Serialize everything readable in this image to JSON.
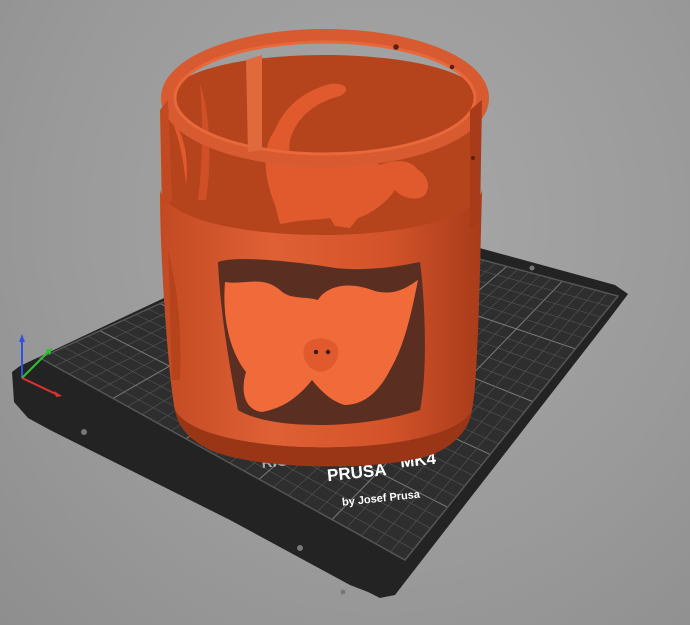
{
  "viewport": {
    "background_color": "#9c9c9c",
    "model_color": "#d4532a",
    "bed_color": "#2e2e2e",
    "grid_color": "#6a6a6a"
  },
  "print_bed": {
    "brand_prefix": "RIGINAL",
    "brand_name": "PRUSA",
    "model_name": "MK4",
    "byline": "by Josef Prusa",
    "brand_accent": "#e8622c"
  },
  "axes": {
    "x_color": "#e03030",
    "y_color": "#30c030",
    "z_color": "#3050e0"
  },
  "model": {
    "description_icon": "halloween-lantern-model"
  }
}
